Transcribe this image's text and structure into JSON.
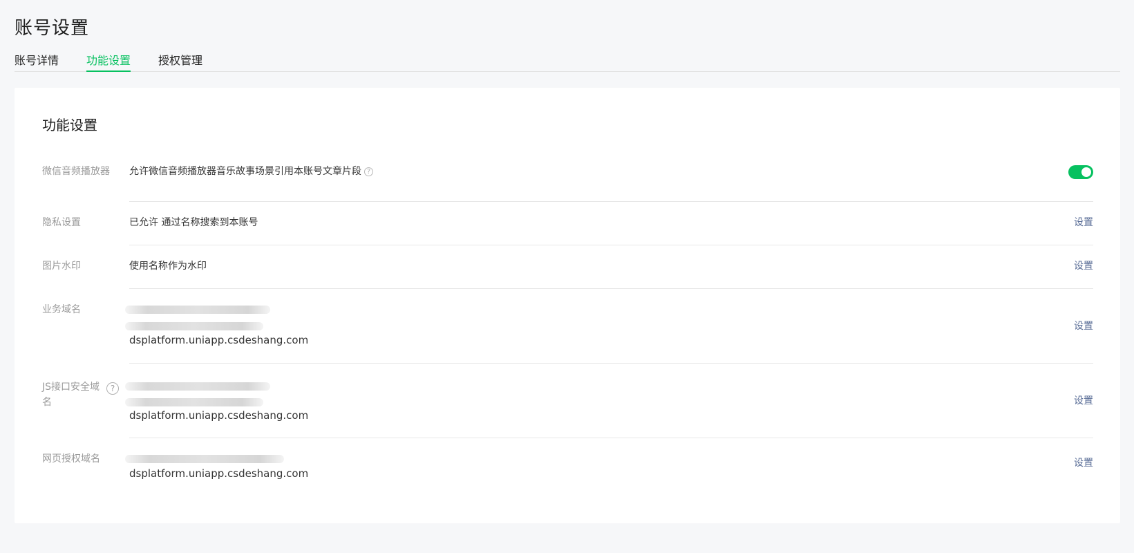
{
  "header": {
    "title": "账号设置"
  },
  "tabs": [
    {
      "label": "账号详情",
      "active": false
    },
    {
      "label": "功能设置",
      "active": true
    },
    {
      "label": "授权管理",
      "active": false
    }
  ],
  "card": {
    "title": "功能设置",
    "rows": [
      {
        "label": "微信音频播放器",
        "value": "允许微信音频播放器音乐故事场景引用本账号文章片段",
        "control": "toggle",
        "toggle_on": true
      },
      {
        "label": "隐私设置",
        "value": "已允许 通过名称搜索到本账号",
        "action": "设置"
      },
      {
        "label": "图片水印",
        "value": "使用名称作为水印",
        "action": "设置"
      },
      {
        "label": "业务域名",
        "domain": "dsplatform.uniapp.csdeshang.com",
        "action": "设置"
      },
      {
        "label": "JS接口安全域名",
        "domain": "dsplatform.uniapp.csdeshang.com",
        "action": "设置"
      },
      {
        "label": "网页授权域名",
        "domain": "dsplatform.uniapp.csdeshang.com",
        "action": "设置"
      }
    ]
  },
  "icons": {
    "help": "?"
  },
  "colors": {
    "accent": "#07c160",
    "link": "#576b95",
    "background": "#f6f7f9"
  }
}
